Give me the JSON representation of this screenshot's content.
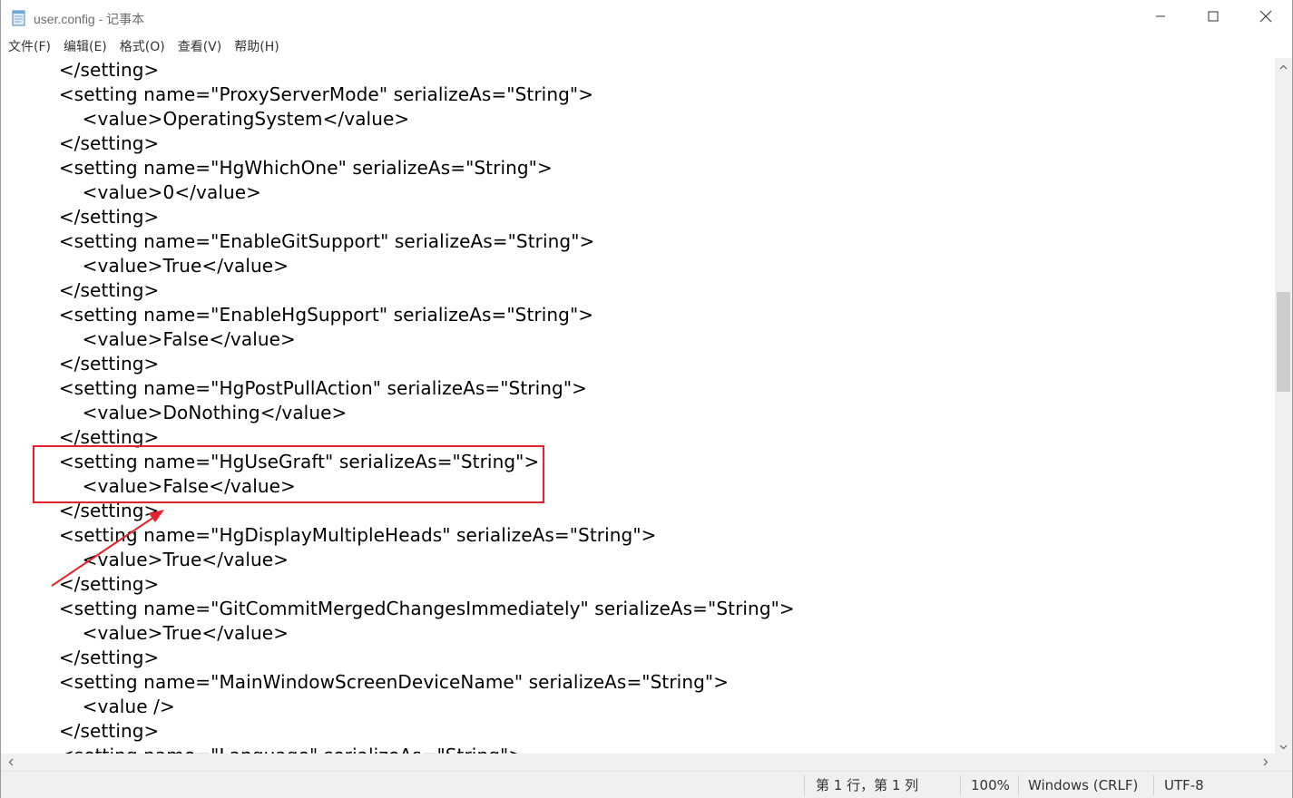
{
  "window": {
    "title": "user.config - 记事本",
    "app_icon": "notepad-icon",
    "controls": [
      "minimize-icon",
      "maximize-icon",
      "close-icon"
    ]
  },
  "menu": {
    "items": [
      {
        "label": "文件(F)"
      },
      {
        "label": "编辑(E)"
      },
      {
        "label": "格式(O)"
      },
      {
        "label": "查看(V)"
      },
      {
        "label": "帮助(H)"
      }
    ]
  },
  "editor": {
    "lines": [
      "    </setting>",
      "    <setting name=\"ProxyServerMode\" serializeAs=\"String\">",
      "        <value>OperatingSystem</value>",
      "    </setting>",
      "    <setting name=\"HgWhichOne\" serializeAs=\"String\">",
      "        <value>0</value>",
      "    </setting>",
      "    <setting name=\"EnableGitSupport\" serializeAs=\"String\">",
      "        <value>True</value>",
      "    </setting>",
      "    <setting name=\"EnableHgSupport\" serializeAs=\"String\">",
      "        <value>False</value>",
      "    </setting>",
      "    <setting name=\"HgPostPullAction\" serializeAs=\"String\">",
      "        <value>DoNothing</value>",
      "    </setting>",
      "    <setting name=\"HgUseGraft\" serializeAs=\"String\">",
      "        <value>False</value>",
      "    </setting>",
      "    <setting name=\"HgDisplayMultipleHeads\" serializeAs=\"String\">",
      "        <value>True</value>",
      "    </setting>",
      "    <setting name=\"GitCommitMergedChangesImmediately\" serializeAs=\"String\">",
      "        <value>True</value>",
      "    </setting>",
      "    <setting name=\"MainWindowScreenDeviceName\" serializeAs=\"String\">",
      "        <value />",
      "    </setting>",
      "    <setting name=\"Language\" serializeAs=\"String\">"
    ]
  },
  "status": {
    "position": "第 1 行，第 1 列",
    "zoom": "100%",
    "line_ending": "Windows (CRLF)",
    "encoding": "UTF-8"
  },
  "annotation": {
    "color": "#e8202a",
    "highlighted_setting": "HgUseGraft"
  }
}
